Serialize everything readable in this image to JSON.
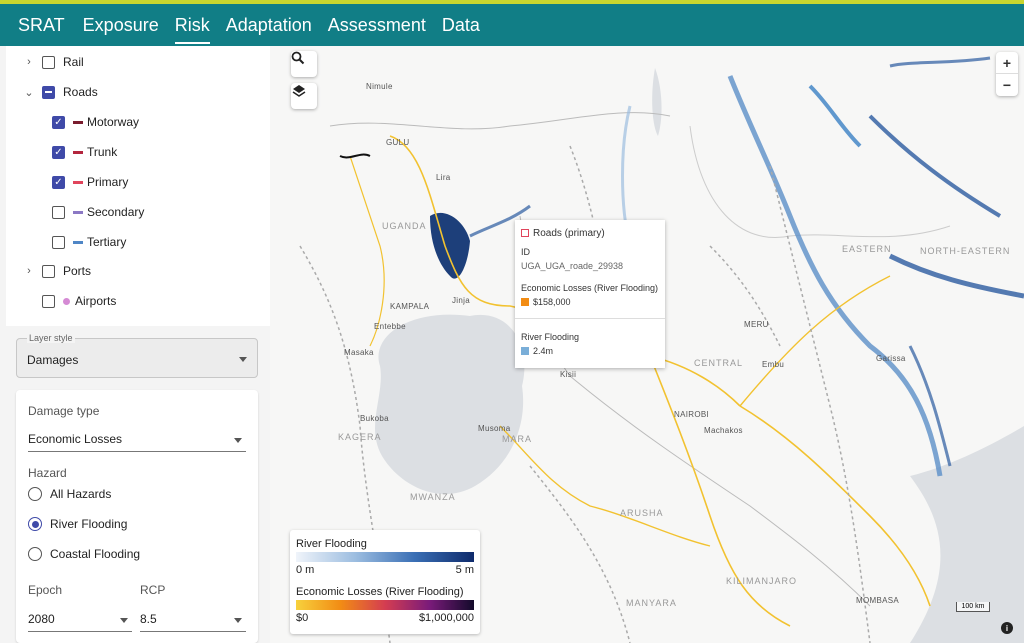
{
  "nav": {
    "brand": "SRAT",
    "items": [
      "Exposure",
      "Risk",
      "Adaptation",
      "Assessment",
      "Data"
    ],
    "active": "Risk"
  },
  "tree": {
    "rail": "Rail",
    "roads": "Roads",
    "motorway": "Motorway",
    "trunk": "Trunk",
    "primary": "Primary",
    "secondary": "Secondary",
    "tertiary": "Tertiary",
    "ports": "Ports",
    "airports": "Airports"
  },
  "colors": {
    "motorway": "#7a1c2e",
    "trunk": "#b3263e",
    "primary": "#e0455c",
    "secondary": "#8b78c4",
    "tertiary": "#4f86c6",
    "airports": "#d58ad4",
    "teal": "#117e86",
    "accent": "#3f4aa8"
  },
  "layer_style": {
    "label": "Layer style",
    "value": "Damages"
  },
  "damage": {
    "type_label": "Damage type",
    "type_value": "Economic Losses",
    "hazard_label": "Hazard",
    "hazards": [
      "All Hazards",
      "River Flooding",
      "Coastal Flooding"
    ],
    "selected_hazard": "River Flooding",
    "epoch_label": "Epoch",
    "epoch_value": "2080",
    "rcp_label": "RCP",
    "rcp_value": "8.5"
  },
  "tooltip": {
    "title": "Roads (primary)",
    "id_label": "ID",
    "id_value": "UGA_UGA_roade_29938",
    "loss_label": "Economic Losses (River Flooding)",
    "loss_value": "$158,000",
    "flood_label": "River Flooding",
    "flood_value": "2.4m"
  },
  "legend": {
    "flood_title": "River Flooding",
    "flood_min": "0 m",
    "flood_max": "5 m",
    "loss_title": "Economic Losses (River Flooding)",
    "loss_min": "$0",
    "loss_max": "$1,000,000"
  },
  "map": {
    "places": [
      "Nimule",
      "GULU",
      "Lira",
      "UGANDA",
      "KAMPALA",
      "Jinja",
      "Entebbe",
      "Masaka",
      "Bukoba",
      "KAGERA",
      "Musoma",
      "MARA",
      "MWANZA",
      "Kisii",
      "NAIROBI",
      "Machakos",
      "CENTRAL",
      "MERU",
      "Embu",
      "EASTERN",
      "NORTH-EASTERN",
      "Garissa",
      "ARUSHA",
      "KILIMANJARO",
      "MANYARA",
      "MOMBASA"
    ],
    "scale": "100 km",
    "zoom_in": "+",
    "zoom_out": "−",
    "info": "i"
  }
}
